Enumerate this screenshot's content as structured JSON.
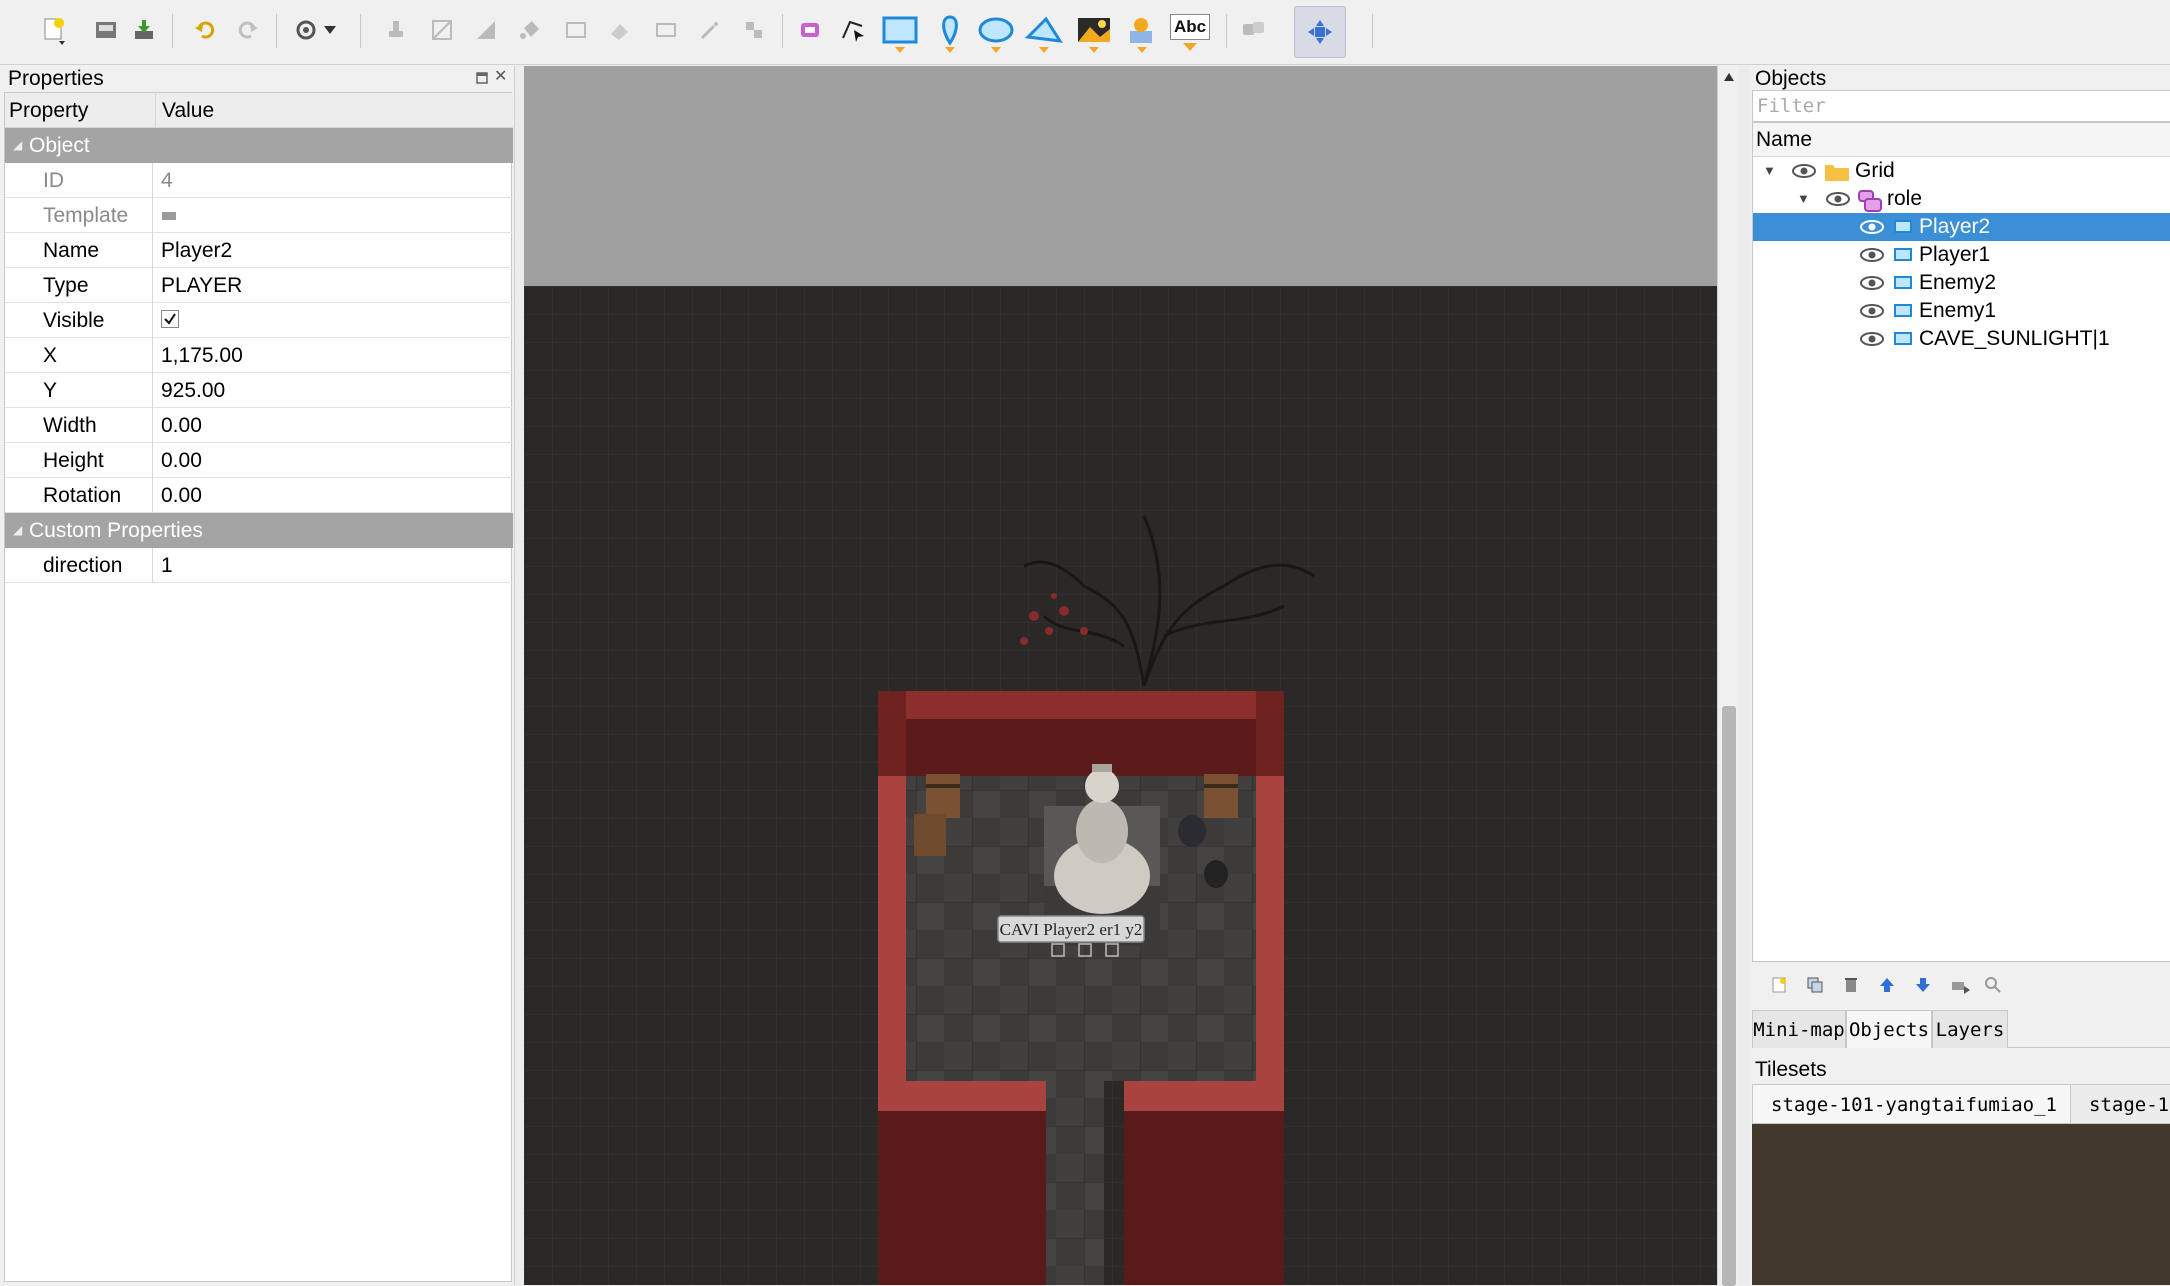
{
  "toolbar": {
    "buttons": [
      "new-icon",
      "open-icon",
      "save-icon",
      "undo-icon",
      "redo-icon",
      "commands-icon",
      "stamp-brush-icon",
      "terrain-brush-icon",
      "wang-brush-icon",
      "bucket-fill-icon",
      "shape-fill-icon",
      "eraser-icon",
      "rect-select-icon",
      "magic-wand-icon",
      "select-same-tile-icon",
      "select-objects-icon",
      "edit-polygons-icon",
      "insert-rectangle-icon",
      "insert-point-icon",
      "insert-ellipse-icon",
      "insert-polygon-icon",
      "insert-tile-icon",
      "insert-template-icon",
      "insert-text-icon",
      "random-mode-icon",
      "move-tool-icon"
    ],
    "text_tool_label": "Abc"
  },
  "properties": {
    "title": "Properties",
    "header": {
      "property": "Property",
      "value": "Value"
    },
    "group_object": "Object",
    "rows": [
      {
        "key": "ID",
        "value": "4",
        "dim": true
      },
      {
        "key": "Template",
        "value": "",
        "dim": true
      },
      {
        "key": "Name",
        "value": "Player2"
      },
      {
        "key": "Type",
        "value": "PLAYER"
      },
      {
        "key": "Visible",
        "value": ""
      },
      {
        "key": "X",
        "value": "1,175.00"
      },
      {
        "key": "Y",
        "value": "925.00"
      },
      {
        "key": "Width",
        "value": "0.00"
      },
      {
        "key": "Height",
        "value": "0.00"
      },
      {
        "key": "Rotation",
        "value": "0.00"
      }
    ],
    "group_custom": "Custom Properties",
    "custom_rows": [
      {
        "key": "direction",
        "value": "1"
      }
    ]
  },
  "map": {
    "overlay_label": "CAVI Player2 er1 y2",
    "colors": {
      "background": "#2b2927",
      "wall": "#8c2e2b",
      "floor": "#3c3b39"
    }
  },
  "objects": {
    "title": "Objects",
    "filter_placeholder": "Filter",
    "header": "Name",
    "tree": [
      {
        "label": "Grid",
        "level": 0,
        "kind": "folder"
      },
      {
        "label": "role",
        "level": 1,
        "kind": "objectgroup"
      },
      {
        "label": "Player2",
        "level": 2,
        "kind": "object",
        "selected": true
      },
      {
        "label": "Player1",
        "level": 2,
        "kind": "object"
      },
      {
        "label": "Enemy2",
        "level": 2,
        "kind": "object"
      },
      {
        "label": "Enemy1",
        "level": 2,
        "kind": "object"
      },
      {
        "label": "CAVE_SUNLIGHT|1",
        "level": 2,
        "kind": "object"
      }
    ],
    "tabs": [
      "Mini-map",
      "Objects",
      "Layers"
    ],
    "active_tab": "Objects"
  },
  "tilesets": {
    "title": "Tilesets",
    "tabs": [
      "stage-101-yangtaifumiao_1",
      "stage-1("
    ]
  }
}
